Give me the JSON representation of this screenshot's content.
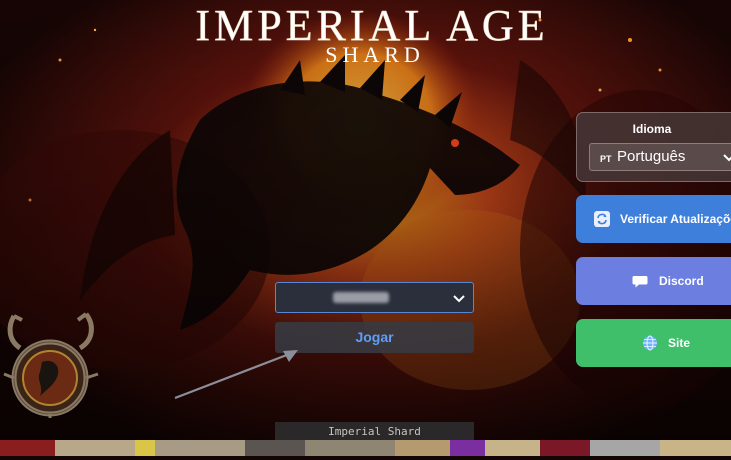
{
  "app": {
    "title_main": "IMPERIAL AGE",
    "title_sub": "SHARD"
  },
  "language_panel": {
    "title": "Idioma",
    "selected_code": "PT",
    "selected_name": "Português"
  },
  "buttons": {
    "update_label": "Verificar Atualizaçõe",
    "discord_label": "Discord",
    "site_label": "Site",
    "play_label": "Jogar"
  },
  "server_select": {
    "selected_value_redacted": true
  },
  "footer": {
    "shard_label": "Imperial Shard"
  },
  "colors": {
    "update_bg": "#3f7fdc",
    "discord_bg": "#6c7ee0",
    "site_bg": "#3fbf6a",
    "play_text": "#5f9df7"
  },
  "icons": {
    "update": "refresh-icon",
    "discord": "chat-bubble-icon",
    "site": "globe-icon",
    "dropdown": "chevron-down-icon"
  }
}
